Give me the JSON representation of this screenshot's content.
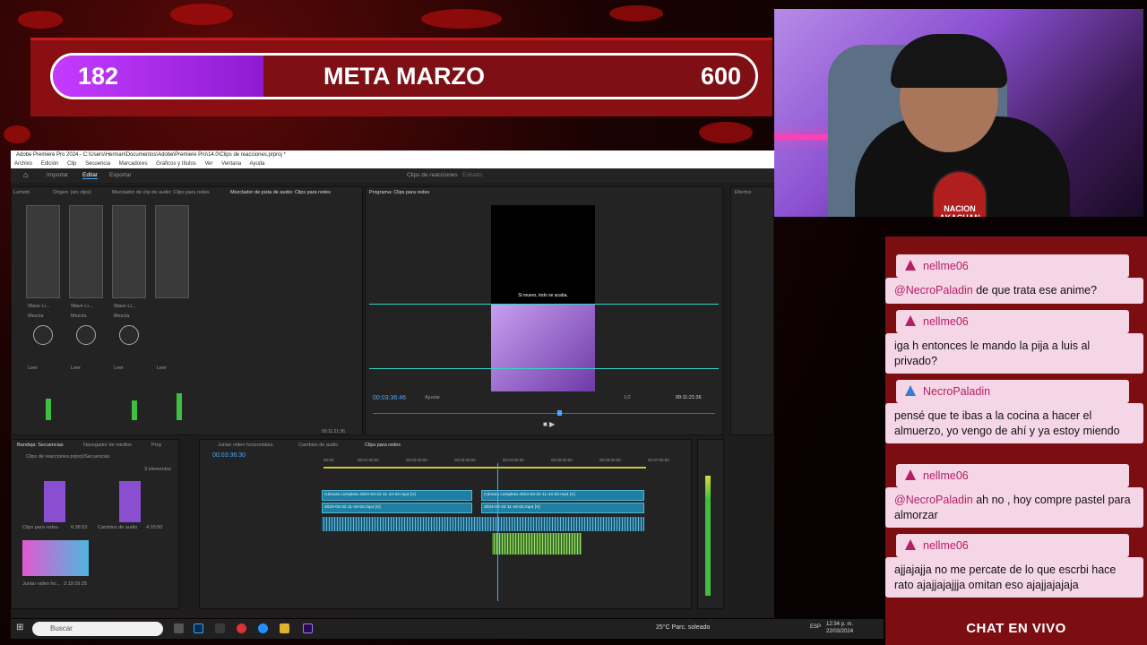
{
  "goal": {
    "current": "182",
    "title": "META MARZO",
    "target": "600",
    "progress_fraction": 0.3
  },
  "brand_colors": {
    "accent": "#8a0f12",
    "goal_fill": "#b23be6",
    "chat_bg": "#7c0e12",
    "chat_msg_bg": "#f5d6e6",
    "username": "#b51e66"
  },
  "webcam": {
    "badge_text": "NACION AKACHAN"
  },
  "chat": {
    "title": "CHAT EN VIVO",
    "messages": [
      {
        "user": "nellme06",
        "mention": "@NecroPaladin",
        "text": " de que trata ese anime?"
      },
      {
        "user": "nellme06",
        "mention": "",
        "text": "iga h entonces le mando la pija a luis al privado?"
      },
      {
        "user": "NecroPaladin",
        "mention": "",
        "text": "pensé que te ibas a la cocina a hacer el almuerzo, yo vengo de ahí y ya estoy miendo"
      },
      {
        "user": "nellme06",
        "mention": "@NecroPaladin",
        "text": " ah no , hoy compre pastel para almorzar"
      },
      {
        "user": "nellme06",
        "mention": "",
        "text": "ajjajajja no me percate de lo que escrbi hace rato ajajjajajjja omitan eso ajajjajajaja"
      }
    ]
  },
  "premiere": {
    "title": "Adobe Premiere Pro 2024 - C:\\Users\\Herman\\Documentos\\Adobe\\Premiere Pro\\14.0\\Clips de reacciones.prproj *",
    "menu": [
      "Archivo",
      "Edición",
      "Clip",
      "Secuencia",
      "Marcadores",
      "Gráficos y títulos",
      "Ver",
      "Ventana",
      "Ayuda"
    ],
    "workspace_tabs": [
      "Importar",
      "Editar",
      "Exportar"
    ],
    "project_title": "Clips de reacciones",
    "edit_state": "Editado",
    "mixer_tabs": [
      "Lumetri",
      "Origen: (sin clips)",
      "Mezclador de clip de audio: Clips para redes",
      "Mezclador de pista de audio: Clips para redes"
    ],
    "program_tab": "Programa: Clips para redes",
    "program_caption": "Si muero, todo se acaba.",
    "program_timecode": "00:03:36:46",
    "program_fit": "Ajustar",
    "program_scale": "1/2",
    "program_duration": "00:11:21:36",
    "effects_tab": "Efectos",
    "effects_items": [
      "Ajustes preestablecidos",
      "Ajustes preestablecidos de Lumetri",
      "Efectos de audio",
      "Transiciones de audio",
      "Efectos de vídeo",
      "Transiciones de vídeo",
      "Bandeja personalizada 01",
      "Bandeja personalizada 02"
    ],
    "side_panels": [
      "Gráficos esenciales",
      "Sonido esencial",
      "Color de Lumetri",
      "Bibliotecas",
      "Marcadores",
      "Historial",
      "Información"
    ],
    "project_tabs": [
      "Bandeja: Secuencias",
      "Navegador de medios",
      "Proy"
    ],
    "project_path": "Clips de reacciones.prproj\\Secuencias",
    "project_count": "3 elementos",
    "project_items": [
      {
        "name": "Clips para redes",
        "duration": "6:38:53"
      },
      {
        "name": "Cambios de audio",
        "duration": "4:10:50"
      },
      {
        "name": "Juntar video ho...",
        "duration": "2:19:39:25"
      }
    ],
    "timeline_tabs": [
      "Juntar vídeo horizontales",
      "Cambios de audio",
      "Clips para redes"
    ],
    "timeline_timecode": "00:03:36:30",
    "ruler": [
      "00:00",
      "00:01:00:00",
      "00:02:00:00",
      "00:03:00:00",
      "00:04:00:00",
      "00:05:00:00",
      "00:06:00:00",
      "00:07:00:00"
    ],
    "clip_v2a": "Cámara completa 2024-03-22 11-44-02.mp4 [V]",
    "clip_v2b": "Cámara completa 2024-03-22 11-44-02.mp4 [V]",
    "clip_v1": "2024-03-22 11-44-02.mp4 [V]",
    "clip_v1b": "2024-03-22 11-44-02.mp4 [V]",
    "mixer_timecode": "00:11:21:36",
    "mix_label": "Mezcla",
    "read_label": "Leer",
    "wave_label": "Wave Li..."
  },
  "taskbar": {
    "search_placeholder": "Buscar",
    "weather": "25°C  Parc. soleado",
    "lang": "ESP",
    "time": "12:34 p. m.",
    "date": "22/03/2024"
  }
}
